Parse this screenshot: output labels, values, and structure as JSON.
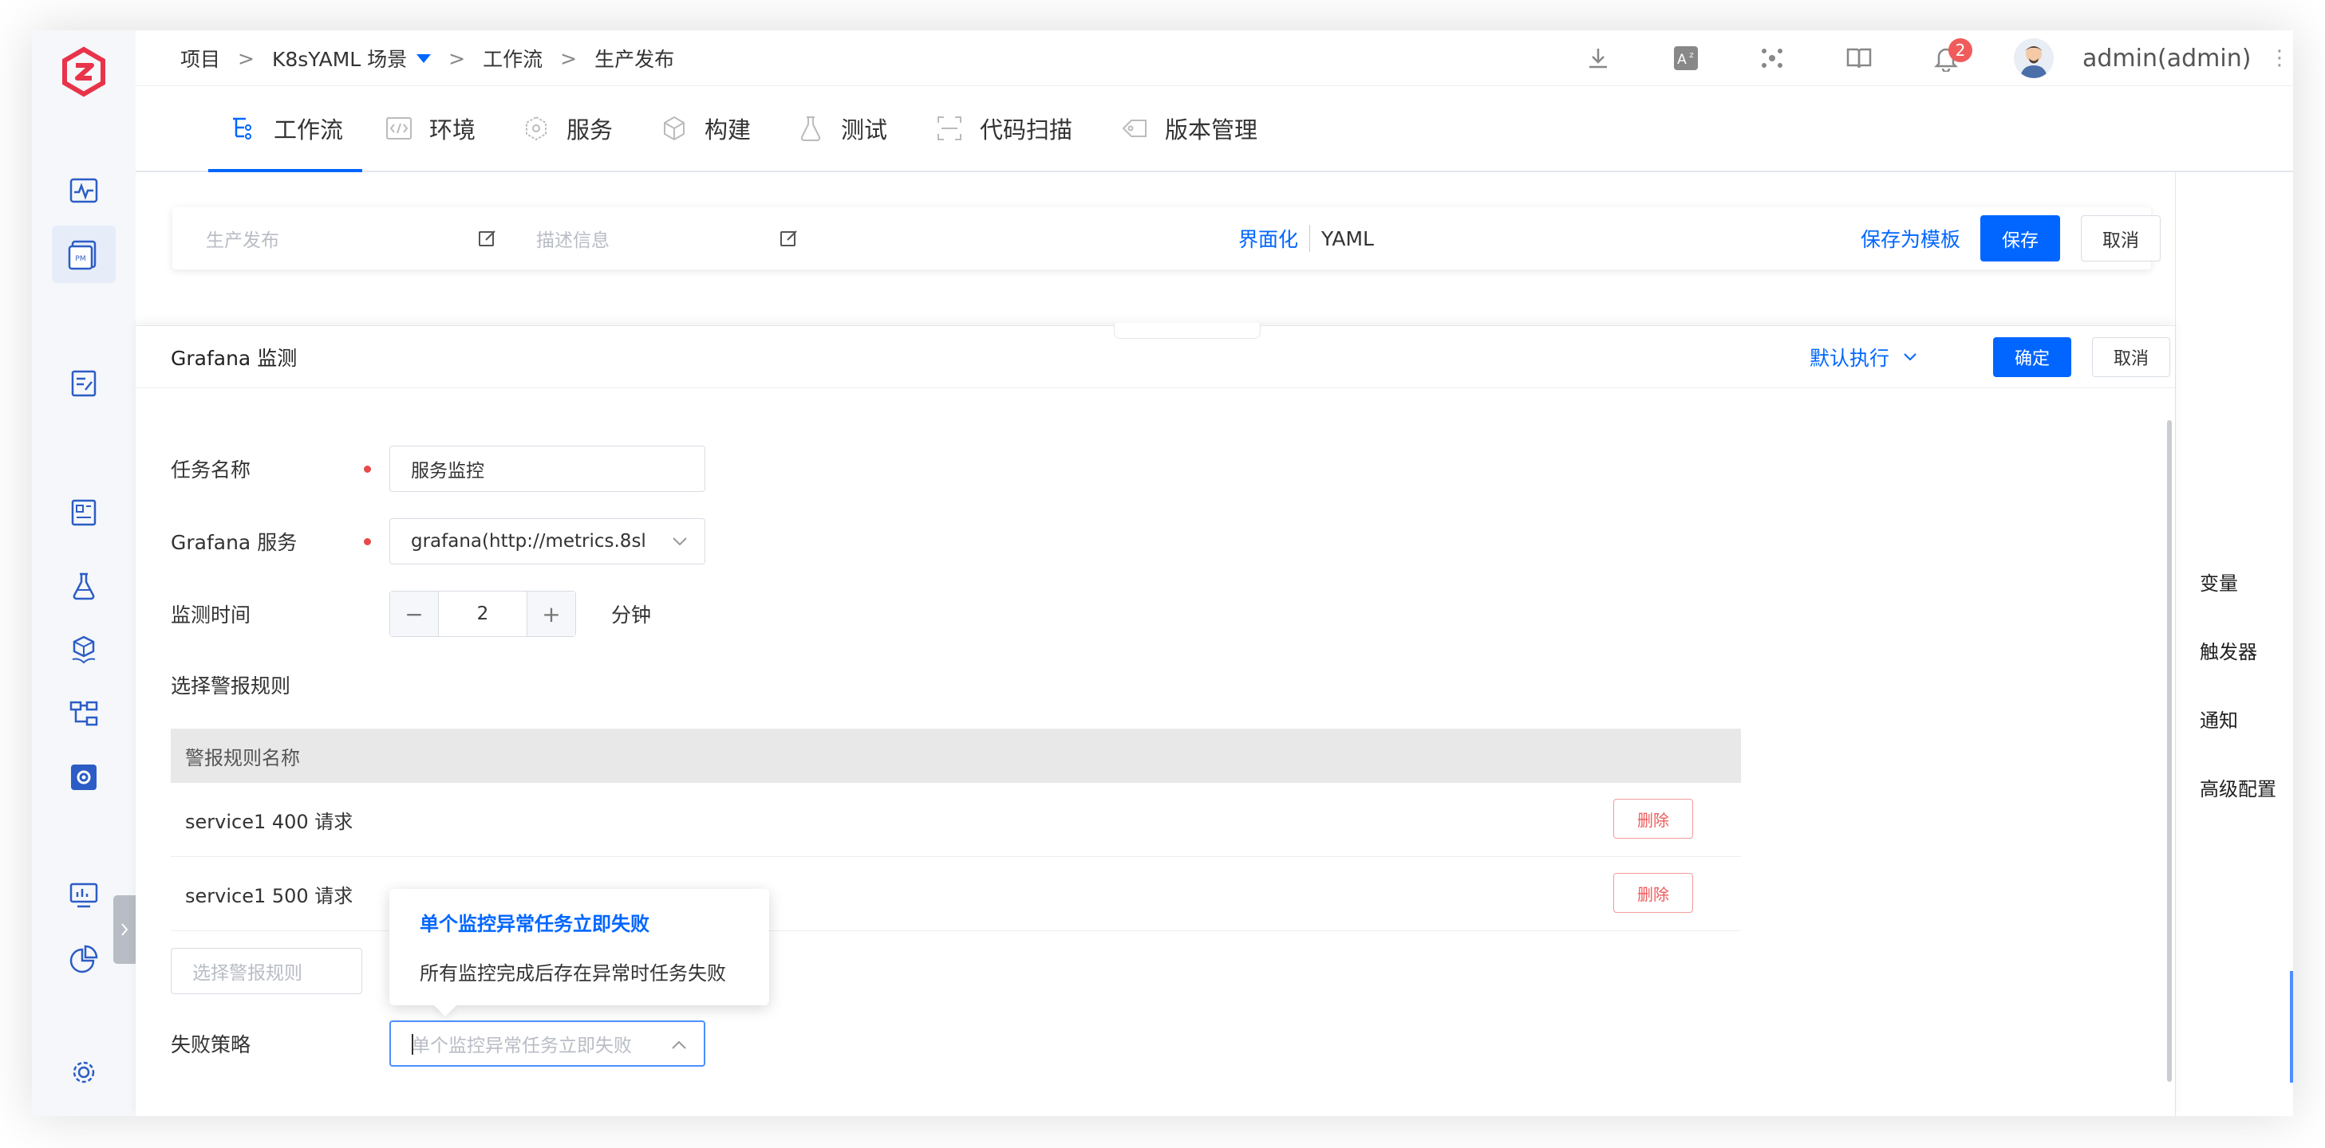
{
  "breadcrumb": {
    "items": [
      "项目",
      "K8sYAML 场景",
      "工作流",
      "生产发布"
    ],
    "sep": ">"
  },
  "header": {
    "notification_count": "2",
    "username": "admin(admin)",
    "more_icon": "⋮"
  },
  "tabs": [
    {
      "label": "工作流",
      "icon": "workflow-icon"
    },
    {
      "label": "环境",
      "icon": "code-icon"
    },
    {
      "label": "服务",
      "icon": "service-icon"
    },
    {
      "label": "构建",
      "icon": "cube-icon"
    },
    {
      "label": "测试",
      "icon": "flask-icon"
    },
    {
      "label": "代码扫描",
      "icon": "scan-icon"
    },
    {
      "label": "版本管理",
      "icon": "tag-icon"
    }
  ],
  "editor": {
    "name_placeholder": "生产发布",
    "desc_placeholder": "描述信息",
    "mode_visual": "界面化",
    "mode_yaml": "YAML",
    "save_template": "保存为模板",
    "save": "保存",
    "cancel": "取消"
  },
  "right_panel": [
    "变量",
    "触发器",
    "通知",
    "高级配置"
  ],
  "drawer": {
    "title": "Grafana 监测",
    "exec_mode": "默认执行",
    "confirm": "确定",
    "cancel": "取消",
    "task_name_label": "任务名称",
    "task_name_value": "服务监控",
    "grafana_label": "Grafana 服务",
    "grafana_value": "grafana(http://metrics.8sl",
    "monitor_label": "监测时间",
    "monitor_value": "2",
    "monitor_unit": "分钟",
    "minus": "−",
    "plus": "+",
    "alert_section": "选择警报规则",
    "table_header": "警报规则名称",
    "rules": [
      {
        "name": "service1 400 请求",
        "action": "删除"
      },
      {
        "name": "service1 500 请求",
        "action": "删除"
      }
    ],
    "rule_select_placeholder": "选择警报规则",
    "strategy_label": "失败策略",
    "strategy_placeholder": "单个监控异常任务立即失败",
    "strategy_options": [
      "单个监控异常任务立即失败",
      "所有监控完成后存在异常时任务失败"
    ]
  },
  "colors": {
    "primary": "#0066ff",
    "danger": "#ef5a5a",
    "badge": "#f05c5c"
  }
}
